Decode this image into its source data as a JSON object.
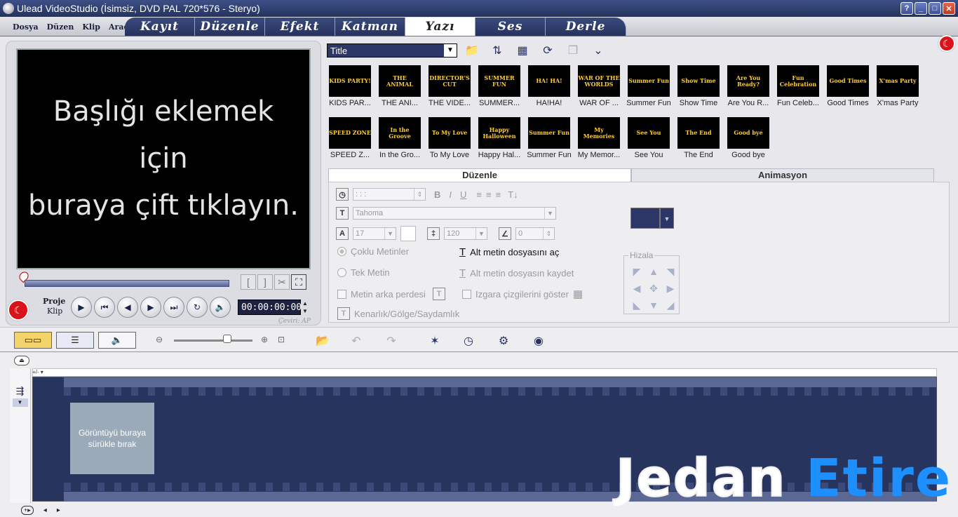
{
  "window": {
    "title": "Ulead VideoStudio (İsimsiz, DVD PAL 720*576 - Steryo)"
  },
  "menus": [
    "Dosya",
    "Düzen",
    "Klip",
    "Araçlar"
  ],
  "tabs": [
    {
      "label": "Kayıt",
      "active": false
    },
    {
      "label": "Düzenle",
      "active": false
    },
    {
      "label": "Efekt",
      "active": false
    },
    {
      "label": "Katman",
      "active": false
    },
    {
      "label": "Yazı",
      "active": true
    },
    {
      "label": "Ses",
      "active": false
    },
    {
      "label": "Derle",
      "active": false
    }
  ],
  "preview": {
    "lines": [
      "Başlığı eklemek",
      "için",
      "buraya çift tıklayın."
    ]
  },
  "playback": {
    "project_label": "Proje",
    "clip_label": "Klip",
    "timecode": "00:00:00:00",
    "credit": "Çeviri: AP"
  },
  "library": {
    "category": "Title",
    "items": [
      {
        "caption": "KIDS PAR...",
        "thumb": "KIDS PARTY!"
      },
      {
        "caption": "THE ANI...",
        "thumb": "THE ANIMAL"
      },
      {
        "caption": "THE VIDE...",
        "thumb": "DIRECTOR'S CUT"
      },
      {
        "caption": "SUMMER...",
        "thumb": "SUMMER FUN"
      },
      {
        "caption": "HA!HA!",
        "thumb": "HA! HA!"
      },
      {
        "caption": "WAR OF ...",
        "thumb": "WAR OF THE WORLDS"
      },
      {
        "caption": "Summer Fun",
        "thumb": "Summer Fun"
      },
      {
        "caption": "Show Time",
        "thumb": "Show Time"
      },
      {
        "caption": "Are You R...",
        "thumb": "Are You Ready?"
      },
      {
        "caption": "Fun Celeb...",
        "thumb": "Fun Celebration"
      },
      {
        "caption": "Good Times",
        "thumb": "Good Times"
      },
      {
        "caption": "X'mas Party",
        "thumb": "X'mas Party"
      },
      {
        "caption": "SPEED Z...",
        "thumb": "SPEED ZONE"
      },
      {
        "caption": "In the Gro...",
        "thumb": "In the Groove"
      },
      {
        "caption": "To My Love",
        "thumb": "To My Love"
      },
      {
        "caption": "Happy Hal...",
        "thumb": "Happy Halloween"
      },
      {
        "caption": "Summer Fun",
        "thumb": "Summer Fun"
      },
      {
        "caption": "My Memor...",
        "thumb": "My Memories"
      },
      {
        "caption": "See You",
        "thumb": "See You"
      },
      {
        "caption": "The End",
        "thumb": "The End"
      },
      {
        "caption": "Good bye",
        "thumb": "Good bye"
      }
    ]
  },
  "options": {
    "tabs": [
      "Düzenle",
      "Animasyon"
    ],
    "time_field": ":   :   :",
    "font": "Tahoma",
    "font_size": "17",
    "line_spacing": "120",
    "angle": "0",
    "multi_text": "Çoklu Metinler",
    "single_text": "Tek Metin",
    "text_backdrop": "Metin arka perdesi",
    "open_subtitle": "Alt metin dosyasını aç",
    "save_subtitle": "Alt metin dosyasın kaydet",
    "show_grid": "Izgara çizgilerini göster",
    "border_shadow": "Kenarlık/Gölge/Saydamlık",
    "align_label": "Hizala",
    "color": "#2c3768"
  },
  "timeline": {
    "ruler_head": "+/- ▾",
    "drop_text": "Görüntüyü buraya sürükle bırak"
  },
  "watermark": {
    "part1": "Jedan",
    "part2": "Etire"
  }
}
